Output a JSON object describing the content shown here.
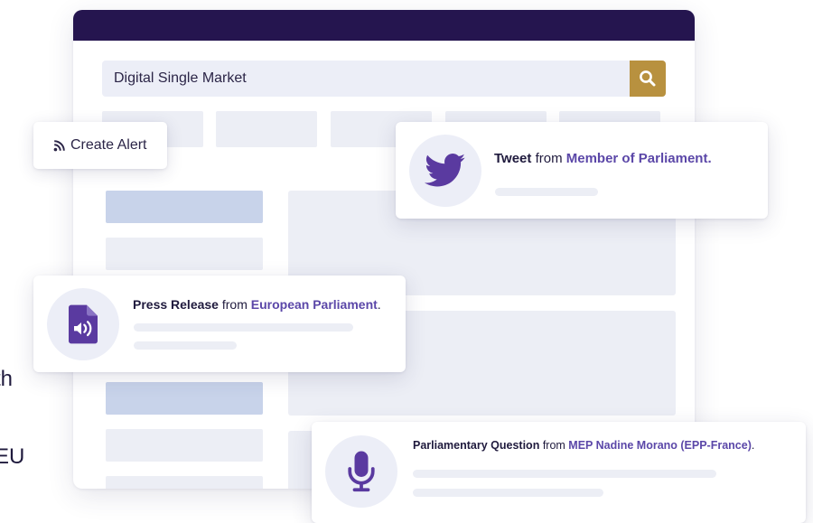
{
  "background_text": {
    "line1": "th",
    "line2": "EU",
    "line3": "."
  },
  "search": {
    "value": "Digital Single Market",
    "button_icon": "search-icon"
  },
  "alert": {
    "label": "Create Alert",
    "icon": "rss-icon"
  },
  "cards": {
    "tweet": {
      "type_label": "Tweet",
      "connector": "from",
      "source": "Member of Parliament.",
      "icon": "twitter-bird-icon"
    },
    "press": {
      "type_label": "Press Release",
      "connector": "from",
      "source": "European Parliament",
      "end": ".",
      "icon": "audio-file-icon"
    },
    "question": {
      "type_label": "Parliamentary Question",
      "connector": "from",
      "source": "MEP Nadine Morano (EPP-France)",
      "end": ".",
      "icon": "microphone-icon"
    }
  },
  "colors": {
    "window_bar": "#25154f",
    "accent_gold": "#b8913f",
    "accent_purple": "#5b47a8",
    "placeholder_blue": "#c8d3ea",
    "placeholder_gray": "#eceef5"
  }
}
